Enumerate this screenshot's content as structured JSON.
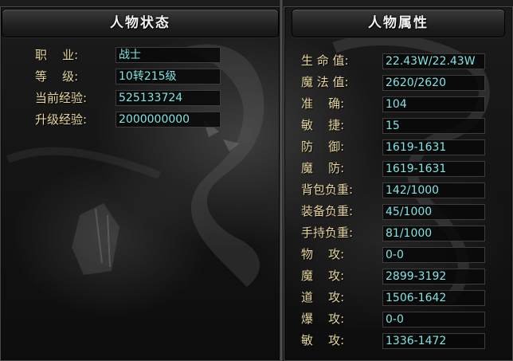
{
  "left_panel": {
    "title": "人物状态",
    "rows": [
      {
        "label": "职    业:",
        "value": "战士"
      },
      {
        "label": "等    级:",
        "value": "10转215级"
      },
      {
        "label": "当前经验:",
        "value": "525133724"
      },
      {
        "label": "升级经验:",
        "value": "2000000000"
      }
    ]
  },
  "right_panel": {
    "title": "人物属性",
    "rows": [
      {
        "label": "生 命 值:",
        "value": "22.43W/22.43W"
      },
      {
        "label": "魔 法 值:",
        "value": "2620/2620"
      },
      {
        "label": "准    确:",
        "value": "104"
      },
      {
        "label": "敏    捷:",
        "value": "15"
      },
      {
        "label": "防    御:",
        "value": "1619-1631"
      },
      {
        "label": "魔    防:",
        "value": "1619-1631"
      },
      {
        "label": "背包负重:",
        "value": "142/1000"
      },
      {
        "label": "装备负重:",
        "value": "45/1000"
      },
      {
        "label": "手持负重:",
        "value": "81/1000"
      },
      {
        "label": "物    攻:",
        "value": "0-0"
      },
      {
        "label": "魔    攻:",
        "value": "2899-3192"
      },
      {
        "label": "道    攻:",
        "value": "1506-1642"
      },
      {
        "label": "爆    攻:",
        "value": "0-0"
      },
      {
        "label": "敏    攻:",
        "value": "1336-1472"
      }
    ]
  },
  "colors": {
    "label": "#e6d59b",
    "value": "#7fe6e6",
    "title": "#f3f3f3"
  }
}
